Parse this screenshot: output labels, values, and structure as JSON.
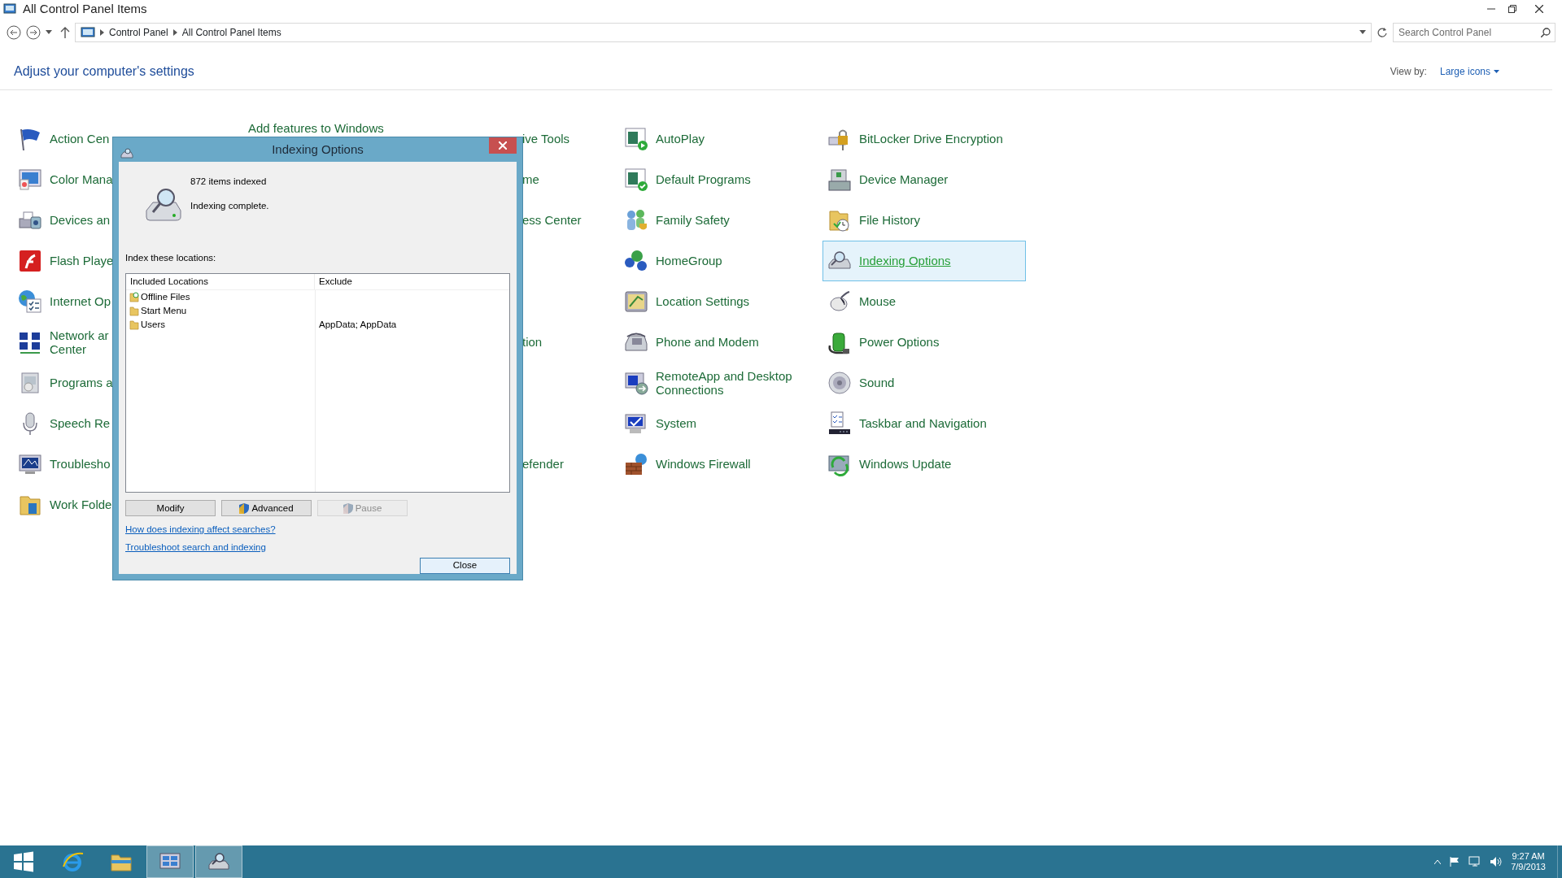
{
  "window": {
    "title": "All Control Panel Items"
  },
  "address_bar": {
    "breadcrumb": [
      "Control Panel",
      "All Control Panel Items"
    ],
    "search": {
      "placeholder": "Search Control Panel"
    }
  },
  "heading": "Adjust your computer's settings",
  "view_by": {
    "label": "View by:",
    "value": "Large icons"
  },
  "rows": [
    {
      "column_1": {
        "lines": [
          "Action Cen"
        ],
        "selected": false
      },
      "column_2": {
        "lines": [
          "Add features to Windows"
        ],
        "selected": false
      },
      "column_3": {
        "lines": [
          "ive Tools"
        ],
        "selected": false
      },
      "column_4": {
        "lines": [
          "AutoPlay"
        ],
        "selected": false
      },
      "column_5": {
        "lines": [
          "BitLocker Drive Encryption"
        ],
        "selected": false
      }
    },
    {
      "column_1": {
        "lines": [
          "Color Mana"
        ],
        "selected": false
      },
      "column_3": {
        "lines": [
          "me"
        ],
        "selected": false
      },
      "column_4": {
        "lines": [
          "Default Programs"
        ],
        "selected": false
      },
      "column_5": {
        "lines": [
          "Device Manager"
        ],
        "selected": false
      }
    },
    {
      "column_1": {
        "lines": [
          "Devices an"
        ],
        "selected": false
      },
      "column_3": {
        "lines": [
          "ess Center"
        ],
        "selected": false
      },
      "column_4": {
        "lines": [
          "Family Safety"
        ],
        "selected": false
      },
      "column_5": {
        "lines": [
          "File History"
        ],
        "selected": false
      }
    },
    {
      "column_1": {
        "lines": [
          "Flash Playe"
        ],
        "selected": false
      },
      "column_4": {
        "lines": [
          "HomeGroup"
        ],
        "selected": false
      },
      "column_5": {
        "lines": [
          "Indexing Options"
        ],
        "selected": true
      }
    },
    {
      "column_1": {
        "lines": [
          "Internet Op"
        ],
        "selected": false
      },
      "column_4": {
        "lines": [
          "Location Settings"
        ],
        "selected": false
      },
      "column_5": {
        "lines": [
          "Mouse"
        ],
        "selected": false
      }
    },
    {
      "column_1": {
        "lines": [
          "Network ar",
          "Center"
        ],
        "selected": false
      },
      "column_3": {
        "lines": [
          "tion"
        ],
        "selected": false
      },
      "column_4": {
        "lines": [
          "Phone and Modem"
        ],
        "selected": false
      },
      "column_5": {
        "lines": [
          "Power Options"
        ],
        "selected": false
      }
    },
    {
      "column_1": {
        "lines": [
          "Programs a"
        ],
        "selected": false
      },
      "column_4": {
        "lines": [
          "RemoteApp and Desktop",
          "Connections"
        ],
        "selected": false
      },
      "column_5": {
        "lines": [
          "Sound"
        ],
        "selected": false
      }
    },
    {
      "column_1": {
        "lines": [
          "Speech Re"
        ],
        "selected": false
      },
      "column_4": {
        "lines": [
          "System"
        ],
        "selected": false
      },
      "column_5": {
        "lines": [
          "Taskbar and Navigation"
        ],
        "selected": false
      }
    },
    {
      "column_1": {
        "lines": [
          "Troublesho"
        ],
        "selected": false
      },
      "column_3": {
        "lines": [
          "efender"
        ],
        "selected": false
      },
      "column_4": {
        "lines": [
          "Windows Firewall"
        ],
        "selected": false
      },
      "column_5": {
        "lines": [
          "Windows Update"
        ],
        "selected": false
      }
    },
    {
      "column_1": {
        "lines": [
          "Work Folde"
        ],
        "selected": false
      }
    }
  ],
  "dialog": {
    "title": "Indexing Options",
    "count": "872 items indexed",
    "status": "Indexing complete.",
    "locations_label": "Index these locations:",
    "table": {
      "columns": [
        "Included Locations",
        "Exclude"
      ],
      "rows": [
        {
          "location": "Offline Files",
          "selected": false
        },
        {
          "location": "Start Menu",
          "selected": false
        },
        {
          "location": "Users",
          "exclude": "AppData; AppData",
          "selected": false
        }
      ]
    },
    "buttons": [
      {
        "label": "Modify",
        "shield": false,
        "disabled": false
      },
      {
        "label": "Advanced",
        "shield": true,
        "disabled": false
      },
      {
        "label": "Pause",
        "shield": true,
        "disabled": true
      }
    ],
    "links": [
      "How does indexing affect searches?",
      "Troubleshoot search and indexing"
    ],
    "close_button": "Close"
  },
  "taskbar": {
    "apps": [
      {
        "selected": false
      },
      {
        "selected": false
      },
      {
        "selected": true
      },
      {
        "selected": true
      }
    ],
    "time": "9:27 AM",
    "date": "7/9/2013"
  }
}
